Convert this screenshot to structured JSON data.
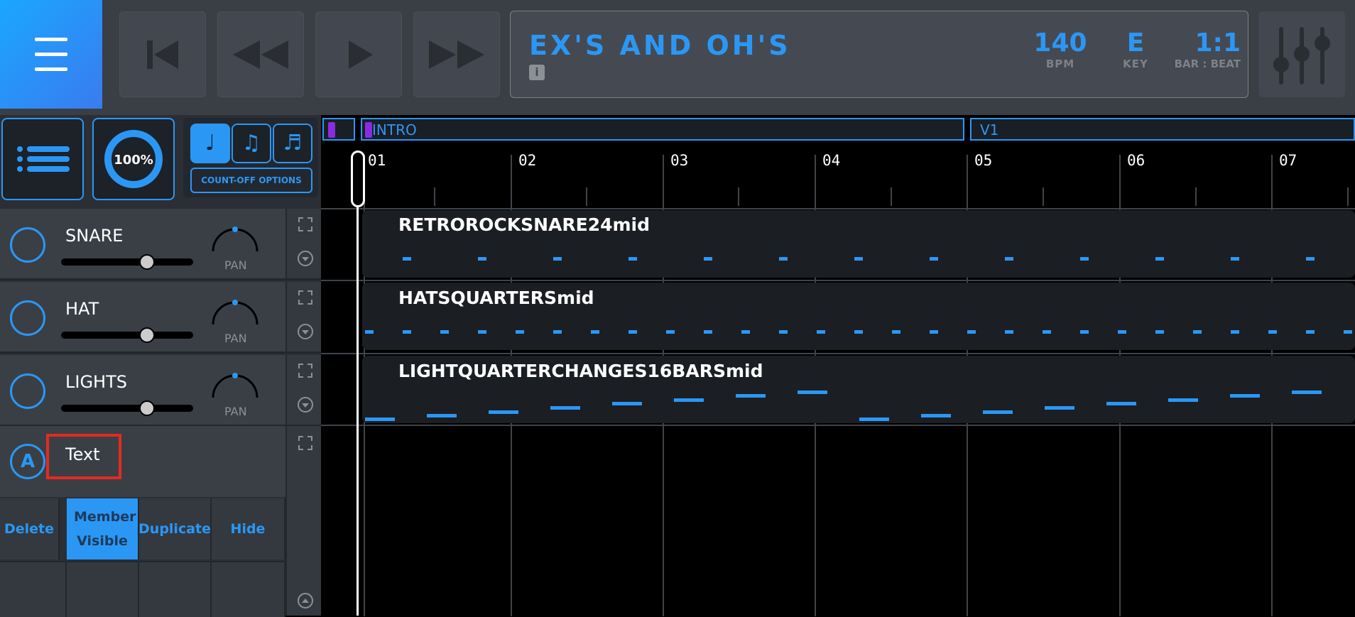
{
  "song": {
    "title": "EX'S AND OH'S",
    "bpm": "140",
    "bpm_label": "BPM",
    "key": "E",
    "key_label": "KEY",
    "position": "1:1",
    "position_label": "BAR : BEAT",
    "info_icon": "i"
  },
  "controls": {
    "tempo_pct": "100%",
    "count_off_label": "COUNT-OFF OPTIONS",
    "note_values": [
      "quarter-note-icon",
      "eighth-note-icon",
      "sixteenth-note-icon"
    ]
  },
  "tracks": [
    {
      "name": "SNARE",
      "pan_label": "PAN",
      "clip": "RETROROCKSNAREmid24mid"
    },
    {
      "name": "HAT",
      "pan_label": "PAN",
      "clip": "HATSQUARTERSmid"
    },
    {
      "name": "LIGHTS",
      "pan_label": "PAN",
      "clip": "LIGHTQUARTERCHANGES16BARSmid"
    }
  ],
  "text_track": {
    "name": "Text",
    "icon": "A",
    "actions": [
      {
        "label": "Delete",
        "active": false
      },
      {
        "label": "Member Visible",
        "active": true
      },
      {
        "label": "Duplicate",
        "active": false
      },
      {
        "label": "Hide",
        "active": false
      }
    ]
  },
  "timeline": {
    "sections": [
      "",
      "INTRO",
      "V1"
    ],
    "bars": [
      "01",
      "02",
      "03",
      "04",
      "05",
      "06",
      "07"
    ]
  },
  "colors": {
    "accent": "#2b97f5",
    "highlight": "#e52a1f",
    "marker": "#8a2be2"
  }
}
